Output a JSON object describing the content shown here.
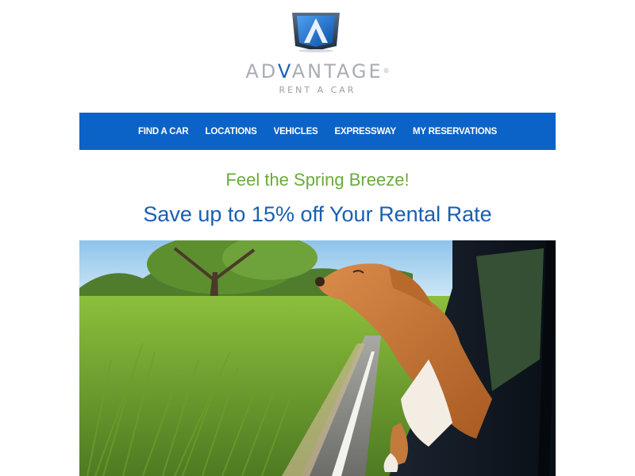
{
  "brand": {
    "name_before": "AD",
    "name_accent": "V",
    "name_after": "ANTAGE",
    "trademark": "®",
    "tagline": "RENT A CAR",
    "primary_color": "#0b63c7",
    "accent_color": "#1f5fb8",
    "logo_icon": "advantage-logo-icon"
  },
  "nav": {
    "items": [
      {
        "label": "FIND A CAR"
      },
      {
        "label": "LOCATIONS"
      },
      {
        "label": "VEHICLES"
      },
      {
        "label": "EXPRESSWAY"
      },
      {
        "label": "MY RESERVATIONS"
      }
    ]
  },
  "promo": {
    "subtitle": "Feel the Spring Breeze!",
    "title": "Save up to 15% off Your Rental Rate",
    "subtitle_color": "#6aab3d",
    "title_color": "#1a5fb0"
  },
  "hero": {
    "image": "dog-leaning-out-car-window-photo"
  }
}
